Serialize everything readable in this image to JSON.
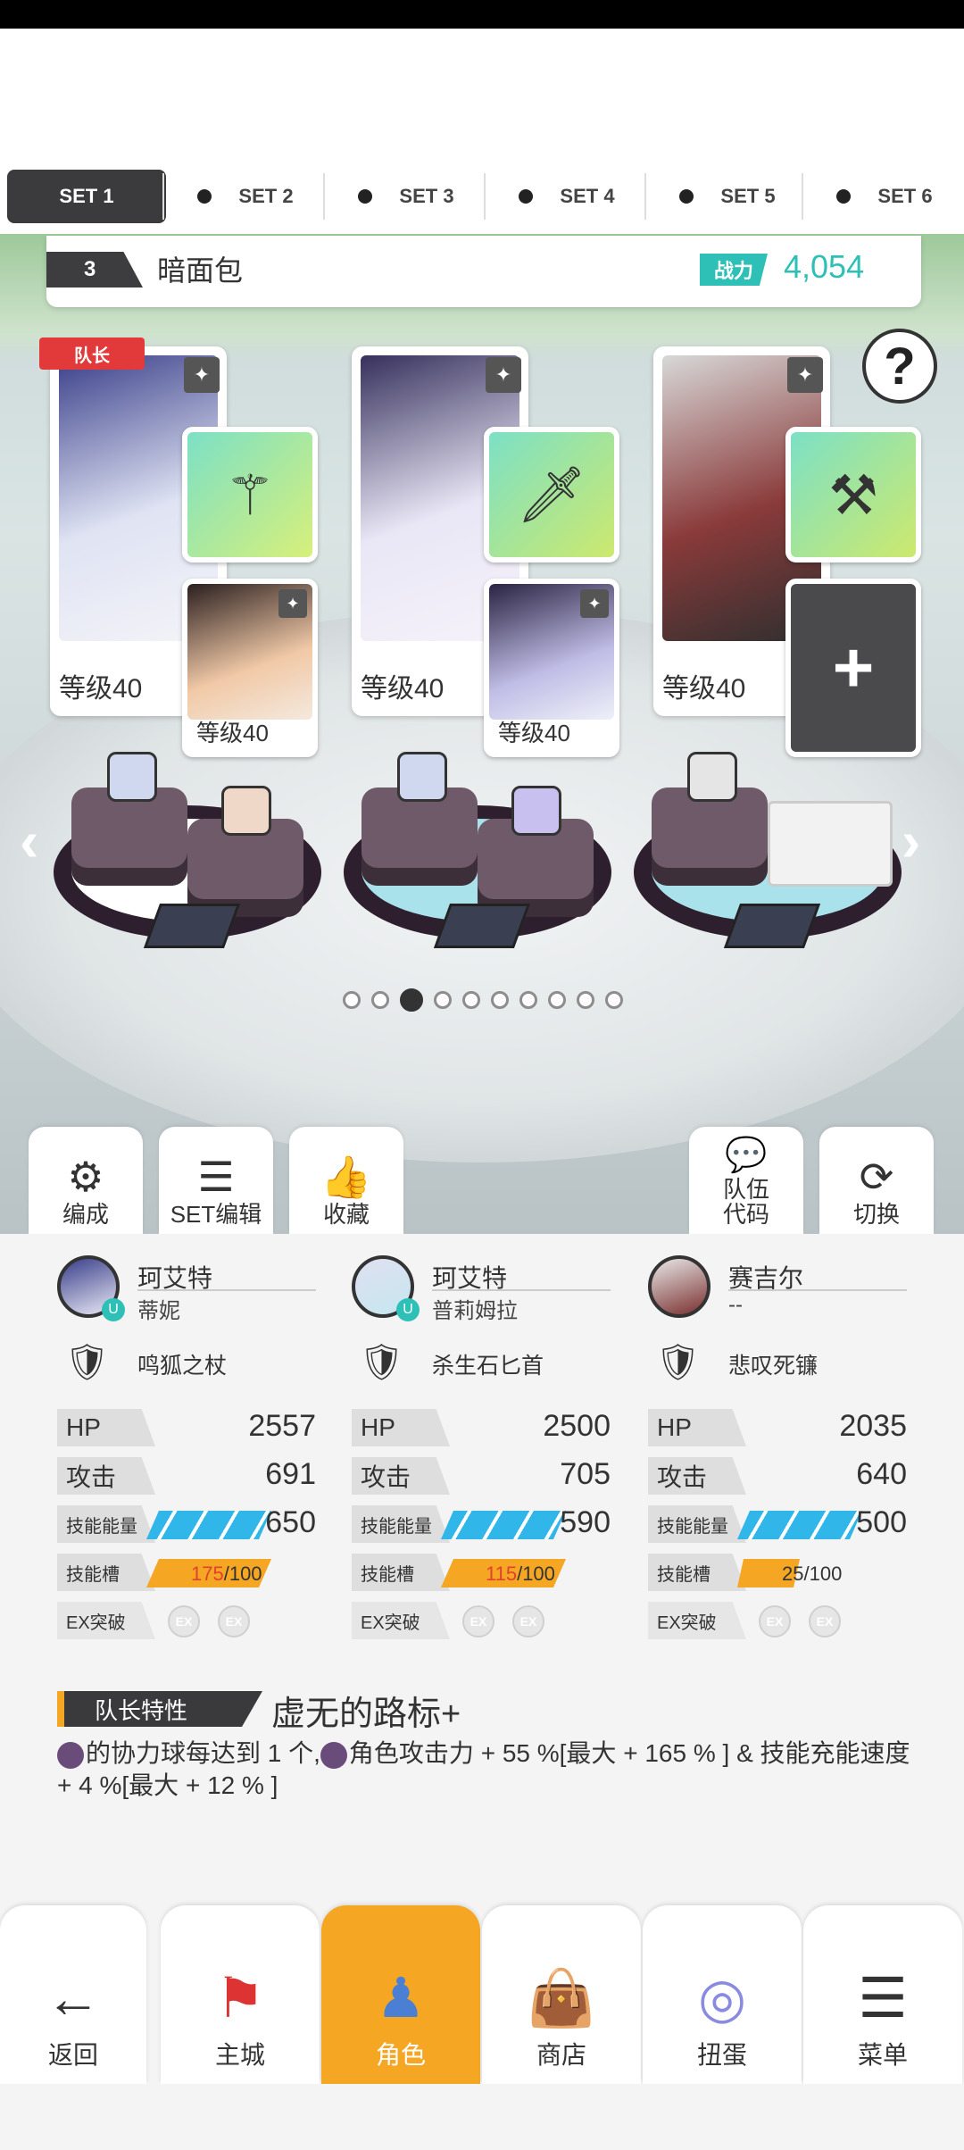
{
  "set_tabs": [
    {
      "label": "SET 1",
      "active": true
    },
    {
      "label": "SET 2",
      "active": false
    },
    {
      "label": "SET 3",
      "active": false
    },
    {
      "label": "SET 4",
      "active": false
    },
    {
      "label": "SET 5",
      "active": false
    },
    {
      "label": "SET 6",
      "active": false
    }
  ],
  "team": {
    "number": "3",
    "name": "暗面包",
    "power_label": "战力",
    "power_value": "4,054",
    "leader_tag": "队长"
  },
  "help_symbol": "?",
  "cards": [
    {
      "level": "等级40",
      "support_level": "等级40"
    },
    {
      "level": "等级40",
      "support_level": "等级40"
    },
    {
      "level": "等级40",
      "add_symbol": "+"
    }
  ],
  "pagination": {
    "total": 10,
    "current": 3
  },
  "action_buttons": {
    "formation": "编成",
    "set_edit": "SET编辑",
    "favorite": "收藏",
    "team_code": "队伍\n代码",
    "switch": "切换"
  },
  "heroes": [
    {
      "name": "珂艾特",
      "subname": "蒂妮",
      "weapon": "鸣狐之杖",
      "hp_label": "HP",
      "hp": "2557",
      "atk_label": "攻击",
      "atk": "691",
      "energy_label": "技能能量",
      "energy": "650",
      "slot_label": "技能槽",
      "slot_cur": "175",
      "slot_max": "/100",
      "ex_label": "EX突破",
      "ex1": "EX",
      "ex2": "EX"
    },
    {
      "name": "珂艾特",
      "subname": "普莉姆拉",
      "weapon": "杀生石匕首",
      "hp_label": "HP",
      "hp": "2500",
      "atk_label": "攻击",
      "atk": "705",
      "energy_label": "技能能量",
      "energy": "590",
      "slot_label": "技能槽",
      "slot_cur": "115",
      "slot_max": "/100",
      "ex_label": "EX突破",
      "ex1": "EX",
      "ex2": "EX"
    },
    {
      "name": "赛吉尔",
      "subname": "--",
      "weapon": "悲叹死镰",
      "hp_label": "HP",
      "hp": "2035",
      "atk_label": "攻击",
      "atk": "640",
      "energy_label": "技能能量",
      "energy": "500",
      "slot_label": "技能槽",
      "slot_cur": "25",
      "slot_max": "/100",
      "ex_label": "EX突破",
      "ex1": "EX",
      "ex2": "EX"
    }
  ],
  "leader_skill": {
    "label": "队长特性",
    "name": "虚无的路标+",
    "desc_part1": "的协力球每达到 1 个,",
    "desc_part2": "角色攻击力 + 55 %[最大 + 165 % ] & 技能充能速度 + 4 %[最大 + 12 % ]"
  },
  "bottom_nav": {
    "back": "返回",
    "town": "主城",
    "character": "角色",
    "shop": "商店",
    "gacha": "扭蛋",
    "menu": "菜单"
  },
  "colors": {
    "accent_orange": "#f5a623",
    "power_teal": "#2ec0b7",
    "energy_blue": "#30b6e8",
    "leader_red": "#e23a3a"
  },
  "icons": [
    "star-icon",
    "help-icon",
    "staff-icon",
    "dagger-icon",
    "scythe-icon",
    "plus-icon",
    "formation-icon",
    "list-icon",
    "favorite-icon",
    "chat-icon",
    "switch-icon",
    "weapon-icon",
    "back-arrow-icon",
    "town-icon",
    "character-icon",
    "shop-icon",
    "gacha-icon",
    "menu-icon"
  ]
}
